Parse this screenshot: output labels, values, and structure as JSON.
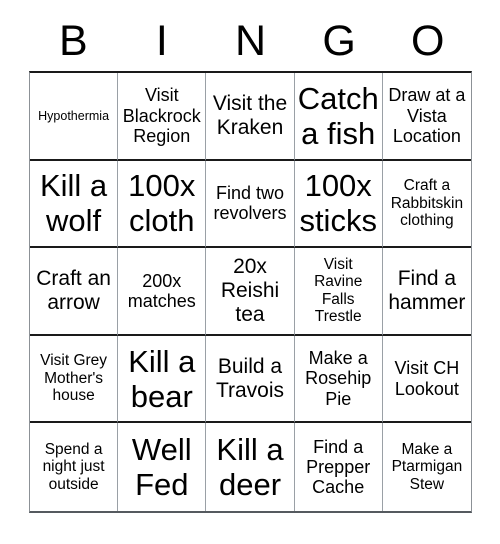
{
  "card": {
    "title": "BINGO",
    "headers": [
      "B",
      "I",
      "N",
      "G",
      "O"
    ],
    "rows": [
      [
        {
          "text": "Hypothermia",
          "size": "xs"
        },
        {
          "text": "Visit Blackrock Region",
          "size": "md"
        },
        {
          "text": "Visit the Kraken",
          "size": "lg"
        },
        {
          "text": "Catch a fish",
          "size": "xxl"
        },
        {
          "text": "Draw at a Vista Location",
          "size": "md"
        }
      ],
      [
        {
          "text": "Kill a wolf",
          "size": "xxl"
        },
        {
          "text": "100x cloth",
          "size": "xxl"
        },
        {
          "text": "Find two revolvers",
          "size": "md"
        },
        {
          "text": "100x sticks",
          "size": "xxl"
        },
        {
          "text": "Craft a Rabbitskin clothing",
          "size": "sm"
        }
      ],
      [
        {
          "text": "Craft an arrow",
          "size": "lg"
        },
        {
          "text": "200x matches",
          "size": "md"
        },
        {
          "text": "20x Reishi tea",
          "size": "lg"
        },
        {
          "text": "Visit Ravine Falls Trestle",
          "size": "sm"
        },
        {
          "text": "Find a hammer",
          "size": "lg"
        }
      ],
      [
        {
          "text": "Visit Grey Mother's house",
          "size": "sm"
        },
        {
          "text": "Kill a bear",
          "size": "xxl"
        },
        {
          "text": "Build a Travois",
          "size": "lg"
        },
        {
          "text": "Make a Rosehip Pie",
          "size": "md"
        },
        {
          "text": "Visit CH Lookout",
          "size": "md"
        }
      ],
      [
        {
          "text": "Spend a night just outside",
          "size": "sm"
        },
        {
          "text": "Well Fed",
          "size": "xxl"
        },
        {
          "text": "Kill a deer",
          "size": "xxl"
        },
        {
          "text": "Find a Prepper Cache",
          "size": "md"
        },
        {
          "text": "Make a Ptarmigan Stew",
          "size": "sm"
        }
      ]
    ]
  },
  "colors": {
    "background": "#ffffff",
    "text": "#000000",
    "grid_line_horizontal": "#1a1a1a",
    "grid_line_vertical": "#9aa0a6"
  }
}
